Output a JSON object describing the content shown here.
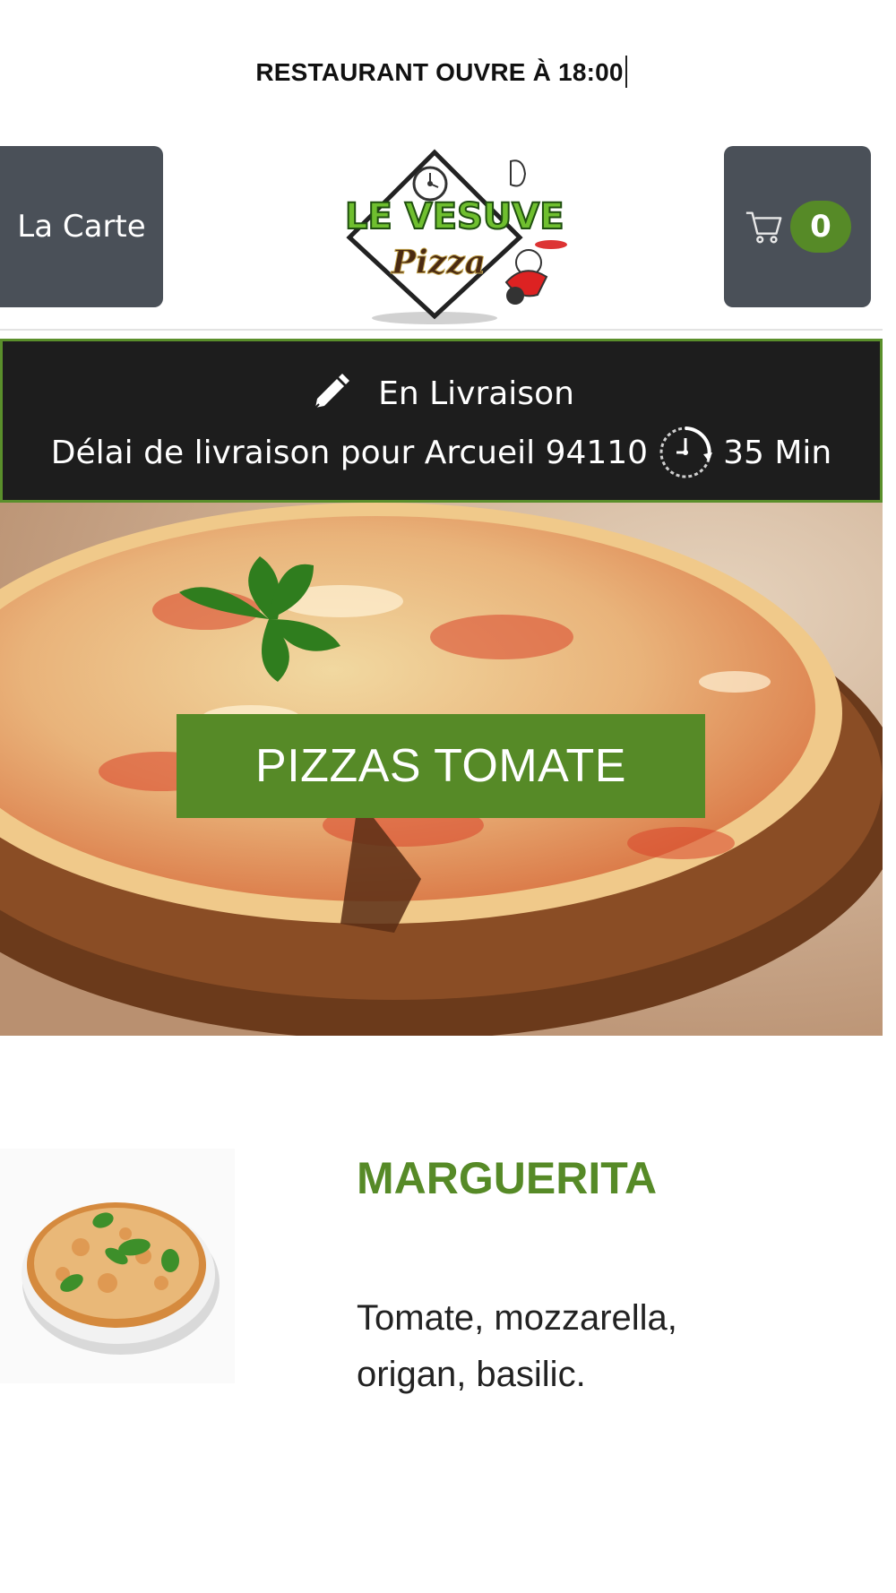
{
  "notice": {
    "text": "RESTAURANT OUVRE À 18:00"
  },
  "header": {
    "menu_label": "La Carte",
    "logo_text_top": "LE VESUVE",
    "logo_text_bottom": "Pizza",
    "cart_count": "0",
    "cart_icon": "cart-icon"
  },
  "delivery": {
    "mode_icon": "pencil-icon",
    "mode_label": "En Livraison",
    "delay_text": "Délai de livraison pour Arcueil 94110",
    "clock_icon": "clock-icon",
    "delay_value": "35 Min"
  },
  "category": {
    "title": "PIZZAS TOMATE"
  },
  "product": {
    "name": "MARGUERITA",
    "description": "Tomate, mozzarella, origan, basilic."
  },
  "colors": {
    "accent": "#568a27",
    "button_bg": "#4a5058",
    "banner_bg": "#1d1d1d"
  }
}
